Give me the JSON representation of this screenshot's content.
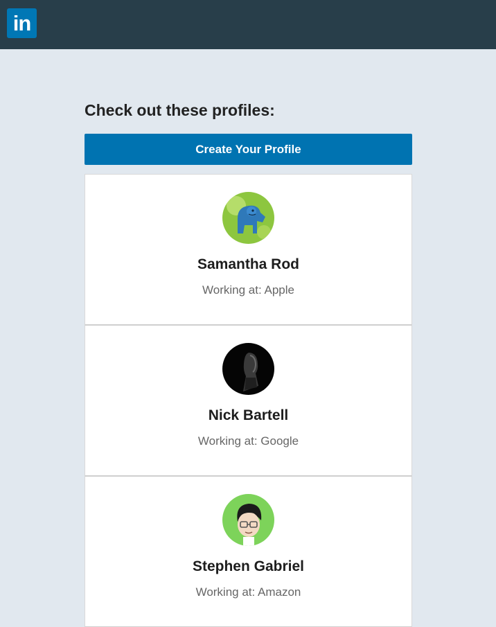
{
  "header": {
    "logo_text": "in",
    "bg_color": "#283e4a",
    "logo_color": "#0077b5"
  },
  "main": {
    "heading": "Check out these profiles:",
    "cta_label": "Create Your Profile",
    "cta_color": "#0073b1"
  },
  "profiles": [
    {
      "name": "Samantha Rod",
      "work": "Working at: Apple",
      "avatar_icon": "gorilla-avatar-icon"
    },
    {
      "name": "Nick Bartell",
      "work": "Working at: Google",
      "avatar_icon": "portrait-avatar-icon"
    },
    {
      "name": "Stephen Gabriel",
      "work": "Working at: Amazon",
      "avatar_icon": "cartoon-glasses-avatar-icon"
    }
  ]
}
